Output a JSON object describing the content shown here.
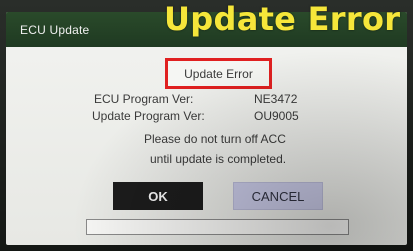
{
  "window": {
    "title": "ECU Update"
  },
  "overlay": {
    "banner_text": "Update Error",
    "banner_color": "#f5e63a"
  },
  "dialog": {
    "status_label": "Update Error",
    "highlight_color": "#e02020",
    "ecu_program_label": "ECU Program Ver:",
    "ecu_program_value": "NE3472",
    "update_program_label": "Update Program Ver:",
    "update_program_value": "OU9005",
    "message_line1": "Please do not turn off ACC",
    "message_line2": "until update is completed."
  },
  "buttons": {
    "ok_label": "OK",
    "cancel_label": "CANCEL"
  },
  "progress": {
    "fraction": 0
  },
  "colors": {
    "titlebar": "#1f3a22",
    "ok_button": "#1c1c1c",
    "cancel_button": "#c8c9e6"
  }
}
